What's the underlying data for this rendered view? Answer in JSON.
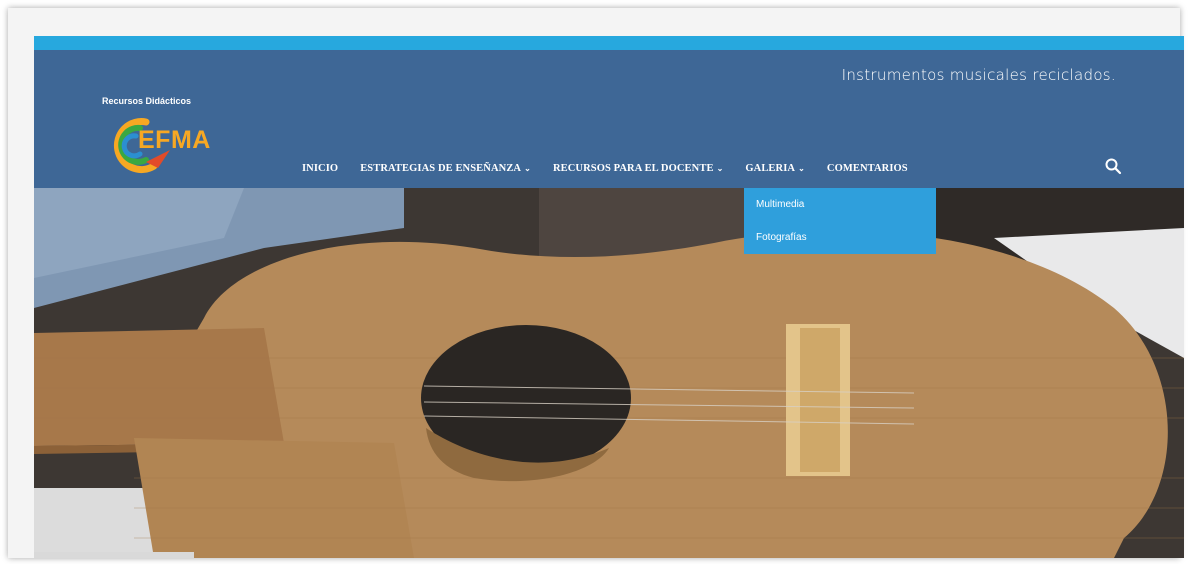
{
  "header": {
    "tagline": "Instrumentos musicales reciclados.",
    "logo_caption": "Recursos Didácticos",
    "logo_text": "EFMA"
  },
  "nav": {
    "items": [
      {
        "label": "INICIO",
        "has_submenu": false
      },
      {
        "label": "ESTRATEGIAS DE ENSEÑANZA",
        "has_submenu": true
      },
      {
        "label": "RECURSOS PARA EL DOCENTE",
        "has_submenu": true
      },
      {
        "label": "GALERIA",
        "has_submenu": true
      },
      {
        "label": "COMENTARIOS",
        "has_submenu": false
      }
    ],
    "search_icon": "search-icon",
    "chevron_icon": "chevron-down-icon"
  },
  "dropdown": {
    "items": [
      "Multimedia",
      "Fotografías"
    ]
  },
  "colors": {
    "accent_stripe": "#27a8de",
    "header_bg": "#3e6796",
    "dropdown_bg": "#2f9fdc",
    "logo_orange": "#f7a823"
  }
}
